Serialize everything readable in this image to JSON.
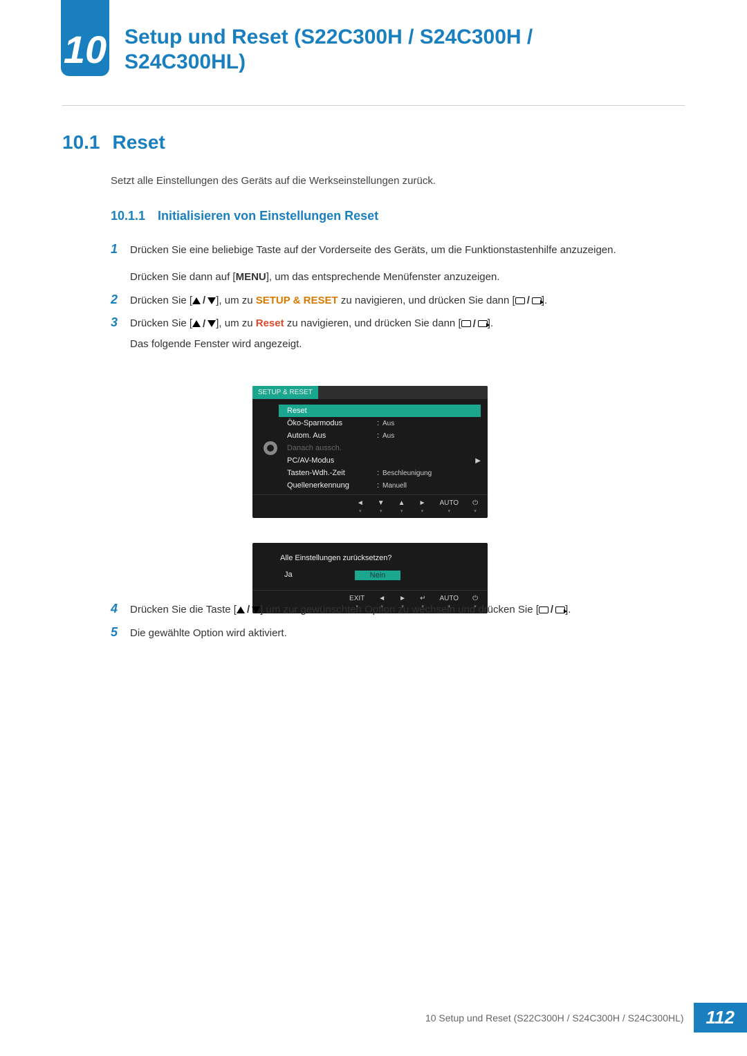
{
  "chapter": {
    "number": "10",
    "title": "Setup und Reset (S22C300H / S24C300H / S24C300HL)"
  },
  "section": {
    "number": "10.1",
    "title": "Reset"
  },
  "intro": "Setzt alle Einstellungen des Geräts auf die Werkseinstellungen zurück.",
  "subsection": {
    "number": "10.1.1",
    "title": "Initialisieren von Einstellungen Reset"
  },
  "steps": {
    "s1a": "Drücken Sie eine beliebige Taste auf der Vorderseite des Geräts, um die Funktionstastenhilfe anzuzeigen.",
    "s1b_pre": "Drücken Sie dann auf [",
    "s1b_btn": "MENU",
    "s1b_post": "], um das entsprechende Menüfenster anzuzeigen.",
    "s2_pre": "Drücken Sie [",
    "s2_mid": "], um zu ",
    "s2_hl": "SETUP & RESET",
    "s2_post": " zu navigieren, und drücken Sie dann [",
    "s2_end": "].",
    "s3_pre": "Drücken Sie [",
    "s3_mid": "], um zu ",
    "s3_hl": "Reset",
    "s3_post": " zu navigieren, und drücken Sie dann [",
    "s3_end": "].",
    "s3_after": "Das folgende Fenster wird angezeigt.",
    "s4_pre": "Drücken Sie die Taste [",
    "s4_mid": "] um zur gewünschten Option zu wechseln und drücken Sie [",
    "s4_end": "].",
    "s5": "Die gewählte Option wird aktiviert."
  },
  "menu": {
    "title": "SETUP & RESET",
    "items": [
      {
        "label": "Reset",
        "value": "",
        "sel": true
      },
      {
        "label": "Öko-Sparmodus",
        "value": "Aus"
      },
      {
        "label": "Autom. Aus",
        "value": "Aus"
      },
      {
        "label": "Danach aussch.",
        "value": "",
        "dis": true
      },
      {
        "label": "PC/AV-Modus",
        "value": "",
        "arrow": true
      },
      {
        "label": "Tasten-Wdh.-Zeit",
        "value": "Beschleunigung"
      },
      {
        "label": "Quellenerkennung",
        "value": "Manuell"
      }
    ],
    "nav": [
      "◄",
      "▼",
      "▲",
      "►",
      "AUTO",
      "⏻"
    ]
  },
  "confirm": {
    "question": "Alle Einstellungen zurücksetzen?",
    "yes": "Ja",
    "no": "Nein",
    "nav": [
      "EXIT",
      "◄",
      "►",
      "↵",
      "AUTO",
      "⏻"
    ]
  },
  "footer": {
    "text": "10 Setup und Reset (S22C300H / S24C300H / S24C300HL)",
    "page": "112"
  }
}
